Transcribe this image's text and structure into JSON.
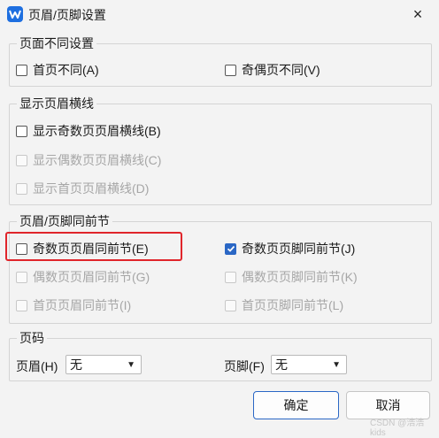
{
  "window": {
    "title": "页眉/页脚设置",
    "close_glyph": "×"
  },
  "groups": {
    "diff": {
      "title": "页面不同设置",
      "first_page": {
        "label": "首页不同(A)",
        "checked": false
      },
      "odd_even": {
        "label": "奇偶页不同(V)",
        "checked": false
      }
    },
    "header_line": {
      "title": "显示页眉横线",
      "odd": {
        "label": "显示奇数页页眉横线(B)",
        "checked": false,
        "enabled": true
      },
      "even": {
        "label": "显示偶数页页眉横线(C)",
        "checked": false,
        "enabled": false
      },
      "first": {
        "label": "显示首页页眉横线(D)",
        "checked": false,
        "enabled": false
      }
    },
    "link_prev": {
      "title": "页眉/页脚同前节",
      "odd_header": {
        "label": "奇数页页眉同前节(E)",
        "checked": false,
        "enabled": true
      },
      "odd_footer": {
        "label": "奇数页页脚同前节(J)",
        "checked": true,
        "enabled": true
      },
      "even_header": {
        "label": "偶数页页眉同前节(G)",
        "checked": false,
        "enabled": false
      },
      "even_footer": {
        "label": "偶数页页脚同前节(K)",
        "checked": false,
        "enabled": false
      },
      "first_header": {
        "label": "首页页眉同前节(I)",
        "checked": false,
        "enabled": false
      },
      "first_footer": {
        "label": "首页页脚同前节(L)",
        "checked": false,
        "enabled": false
      }
    },
    "page_number": {
      "title": "页码",
      "header_label": "页眉(H)",
      "header_value": "无",
      "footer_label": "页脚(F)",
      "footer_value": "无"
    }
  },
  "buttons": {
    "ok": "确定",
    "cancel": "取消"
  },
  "watermark": "CSDN @浩浩kids",
  "colors": {
    "accent": "#2a67c5",
    "highlight": "#e0252b"
  }
}
